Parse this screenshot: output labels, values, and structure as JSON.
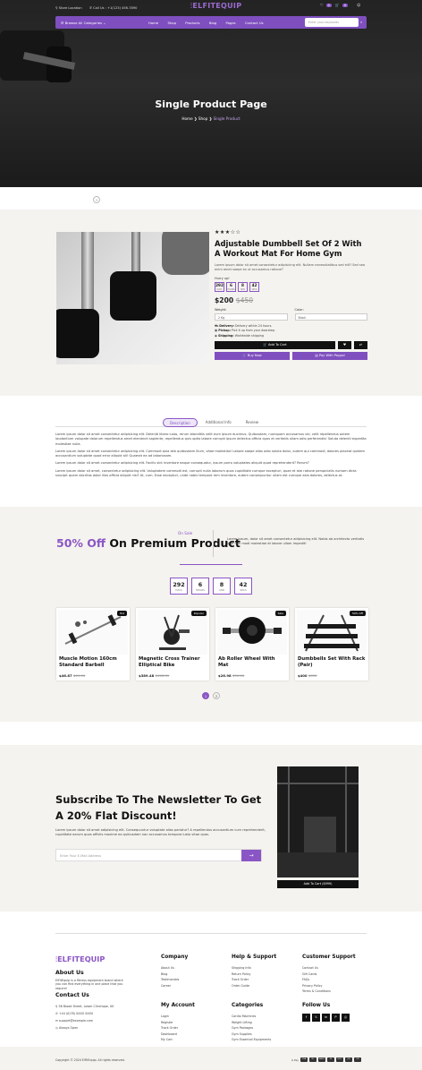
{
  "header": {
    "store_location": "Store Location",
    "call": "Call Us : +1(123) 456-7890",
    "logo": "ELFITEQUIP",
    "wishlist_count": "0",
    "cart_count": "0",
    "browse": "Browse All Categories",
    "menu": [
      "Home",
      "Shop",
      "Products",
      "Blog",
      "Pages",
      "Contact Us"
    ],
    "search_placeholder": "Enter your keywords"
  },
  "hero": {
    "title": "Single Product Page",
    "crumbs": [
      "Home",
      "Shop",
      "Single Product"
    ]
  },
  "product": {
    "rating": "★★★☆☆",
    "title": "Adjustable Dumbbell Set Of 2 With A Workout Mat For Home Gym",
    "desc": "Lorem ipsum dolor sit amet consectetur adipisicing elit. Nullam necessitatibus sed elit? Sed sea enim amet saepe ex ut accusamus ratione?",
    "hurry": "Hurry up!",
    "countdown": [
      {
        "v": "292",
        "l": "DAYS"
      },
      {
        "v": "6",
        "l": "HOURS"
      },
      {
        "v": "8",
        "l": "MIN"
      },
      {
        "v": "42",
        "l": "SECS"
      }
    ],
    "price": "$200",
    "old_price": "$450",
    "weight_label": "Weight:",
    "weight_value": "2 Kg",
    "color_label": "Color:",
    "color_value": "Black",
    "delivery": "Delivery:",
    "delivery_text": "Delivery within 24 hours.",
    "pickup": "Pickup:",
    "pickup_text": "Pick it up from your doorstep.",
    "shipping": "Shipping:",
    "shipping_text": "Worldwide shipping",
    "add_to_cart": "Add To Cart",
    "buy_now": "Buy Now",
    "pay_paypal": "Pay With Paypal"
  },
  "tabs": {
    "items": [
      "Description",
      "Additional Info",
      "Review"
    ],
    "paragraphs": [
      "Lorem ipsum dolor sit amet consectetur adipisicing elit. Deleniti libero iusto, rerum blanditiis velit eum ipsum ducimus. Quibusdam, numquam accusamus vel, velit repellendus autem laudantium volupate dolorum repellendus amet eleniendi sapiente, repellendus quis optio labore corrupti ipsum delectus officia quos et veritatis ullam odio perferendis! Soluta deleniti expedita molestiae nulla.",
      "Lorem ipsum dolor sit amet consectetur adipisicing elit. Commodi quia iste quibusdam illum, vitae molestias! Labore saepe alias odio soluta dolor, autem qui commodi, dolores placeat quidem accusantium voluptate quod error aliquid sit! Quaerat ea ad laboriosam.",
      "Lorem ipsum dolor sit amet consectetur adipisicing elit. Facilis sint inventore eaque consequatur, ipsum porro voluptates aliquid quod reprehenderit? Rerum?",
      "Lorem ipsum dolor sit amet, consectetur adipisicing elit. Voluptatem commodi est, corrupti nulla laborum quos cupiditate cumque excepturi, quae et iste ratione perspiciatis numam dicta suscipit quam dacritas dolor illos officia aliquid nisi? At, cum. Esse excepturi, unde nobis tempore rem inventore, autem consequuntur ullam est cumque asla dolores, delectus at."
    ]
  },
  "offer": {
    "on_sale": "On Sale",
    "percent": "50% Off",
    "rest": "On Premium Product",
    "desc": "Lorem ipsum, dolor sit amet consectetur adipisicing elit. Nobis ab architecto veritatis ipsa non modi molestiae et labore ullam impedit!",
    "countdown": [
      {
        "v": "292",
        "l": "DAYS"
      },
      {
        "v": "6",
        "l": "HOURS"
      },
      {
        "v": "8",
        "l": "MIN"
      },
      {
        "v": "42",
        "l": "SECS"
      }
    ],
    "products": [
      {
        "name": "Muscle Motion 160cm Standard Barbell",
        "price": "$46.87",
        "old": "$69.00",
        "tag": "Hot"
      },
      {
        "name": "Magnetic Cross Trainer Elliptical Bike",
        "price": "$389.48",
        "old": "$468.00",
        "tag": "Popular"
      },
      {
        "name": "Ab Roller Wheel With Mat",
        "price": "$26.98",
        "old": "$30.00",
        "tag": "Sale"
      },
      {
        "name": "Dumbbells Set With Rack (Pair)",
        "price": "$400",
        "old": "$650",
        "tag": "50% Off"
      }
    ],
    "pages": [
      "1",
      "2"
    ]
  },
  "newsletter": {
    "title": "Subscribe To The Newsletter To Get A 20% Flat Discount!",
    "desc": "Lorem ipsum dolor sit amet adipisicing elit. Consequuntur voluptate alias pariatur? A repellendus accusantium cum reprehenderit, cupiditate earum quos officiis maxime ea quibusdam non accusamus tempora iusto vitae quas.",
    "placeholder": "Enter Your E-Mail Address",
    "submit_icon": "→",
    "gym_button": "Add To Cart ($999)"
  },
  "footer": {
    "logo": "ELFITEQUIP",
    "about_title": "About Us",
    "about_text": "ElFitEquip is a fitness equipment brand where you can find everything in one place that you require!",
    "contact_title": "Contact Us",
    "contacts": [
      "56 Broad Street, Lower Clinchope, UK",
      "+44 (0)78) XXXX XXXX",
      "support@example.com",
      "Always Open"
    ],
    "company_title": "Company",
    "company": [
      "About Us",
      "Blog",
      "Testimonials",
      "Career"
    ],
    "help_title": "Help & Support",
    "help": [
      "Shipping Info",
      "Return Policy",
      "Track Order",
      "Order Guide"
    ],
    "customer_title": "Customer Support",
    "customer": [
      "Contact Us",
      "Gift Cards",
      "FAQs",
      "Privacy Policy",
      "Terms & Conditions"
    ],
    "account_title": "My Account",
    "account": [
      "Login",
      "Register",
      "Track Order",
      "Dashboard",
      "My Cart"
    ],
    "categories_title": "Categories",
    "categories": [
      "Cardio Machines",
      "Weight Lifting",
      "Gym Packages",
      "Gym Supplies",
      "Gym Essentail Equipments"
    ],
    "follow_title": "Follow Us",
    "social": [
      "f",
      "𝕏",
      "in",
      "P",
      "◎"
    ],
    "copyright": "Copyright © 2024 ElFitEquip. All rights reserved.",
    "pay_label": "G Pay",
    "pay_cards": [
      "VISA",
      "MC",
      "AMEX",
      "PP",
      "DISC",
      "JCB",
      "UPI"
    ]
  }
}
